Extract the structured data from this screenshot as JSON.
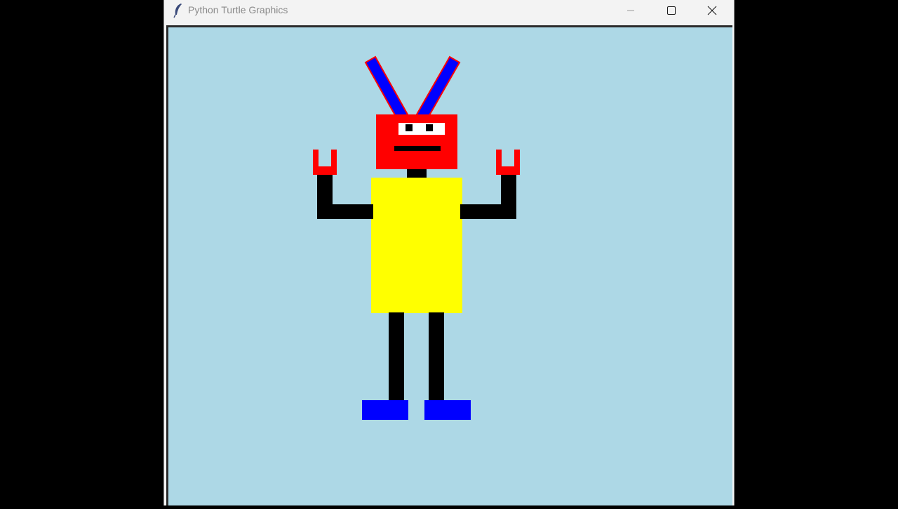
{
  "window": {
    "title": "Python Turtle Graphics",
    "app_icon": "feather-icon",
    "controls": {
      "minimize_icon": "minimize-icon",
      "maximize_icon": "maximize-icon",
      "close_icon": "close-icon"
    }
  },
  "canvas": {
    "background_color": "#add8e6"
  },
  "robot": {
    "colors": {
      "antenna_fill": "#0000ff",
      "antenna_outline": "#ff0000",
      "head": "#ff0000",
      "eyes_band": "#ffffff",
      "pupils": "#000000",
      "mouth": "#000000",
      "neck": "#000000",
      "body": "#ffff00",
      "arms": "#000000",
      "hands": "#ff0000",
      "legs": "#000000",
      "feet": "#0000ff"
    }
  }
}
